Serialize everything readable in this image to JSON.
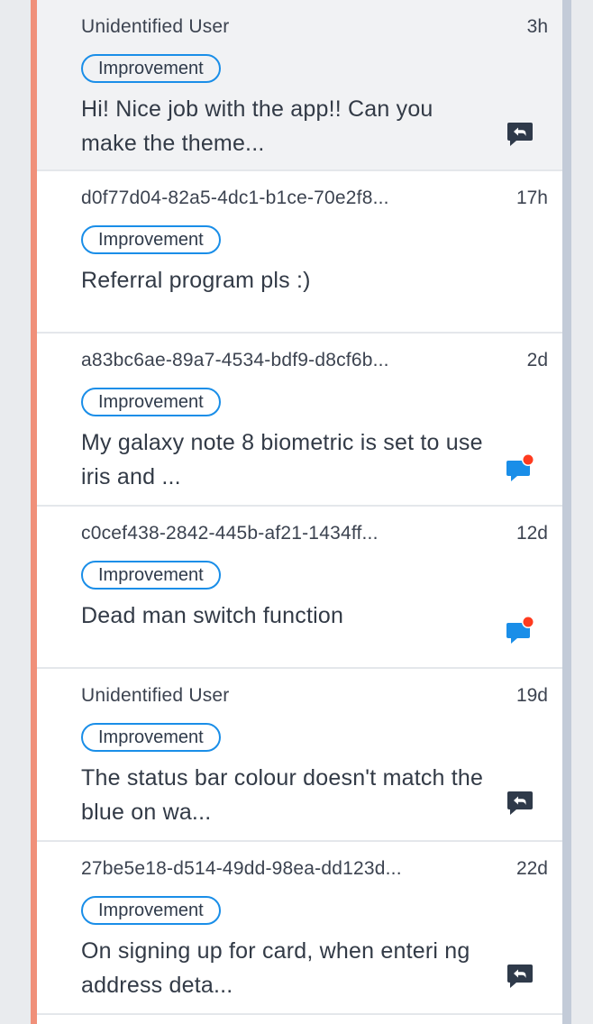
{
  "colors": {
    "accent_strip": "#f0907a",
    "tag_border": "#1a8ee8",
    "icon_dark": "#2f3a4a",
    "icon_blue": "#1a8ee8",
    "unread_dot": "#ff3b1f"
  },
  "feedback": [
    {
      "sender": "Unidentified User",
      "time": "3h",
      "tag": "Improvement",
      "message": "Hi! Nice job with the app!! Can you make the theme...",
      "icon": "reply-icon",
      "selected": true
    },
    {
      "sender": "d0f77d04-82a5-4dc1-b1ce-70e2f8...",
      "time": "17h",
      "tag": "Improvement",
      "message": "Referral program pls :)",
      "icon": "",
      "selected": false
    },
    {
      "sender": "a83bc6ae-89a7-4534-bdf9-d8cf6b...",
      "time": "2d",
      "tag": "Improvement",
      "message": "My galaxy note 8 biometric is set to use iris and ...",
      "icon": "unread-chat-icon",
      "selected": false
    },
    {
      "sender": "c0cef438-2842-445b-af21-1434ff...",
      "time": "12d",
      "tag": "Improvement",
      "message": "Dead man switch function",
      "icon": "unread-chat-icon",
      "selected": false
    },
    {
      "sender": "Unidentified User",
      "time": "19d",
      "tag": "Improvement",
      "message": "The status bar colour doesn't match the blue on wa...",
      "icon": "reply-icon",
      "selected": false
    },
    {
      "sender": "27be5e18-d514-49dd-98ea-dd123d...",
      "time": "22d",
      "tag": "Improvement",
      "message": "On signing up for card, when enteri ng address deta...",
      "icon": "reply-icon",
      "selected": false
    }
  ]
}
